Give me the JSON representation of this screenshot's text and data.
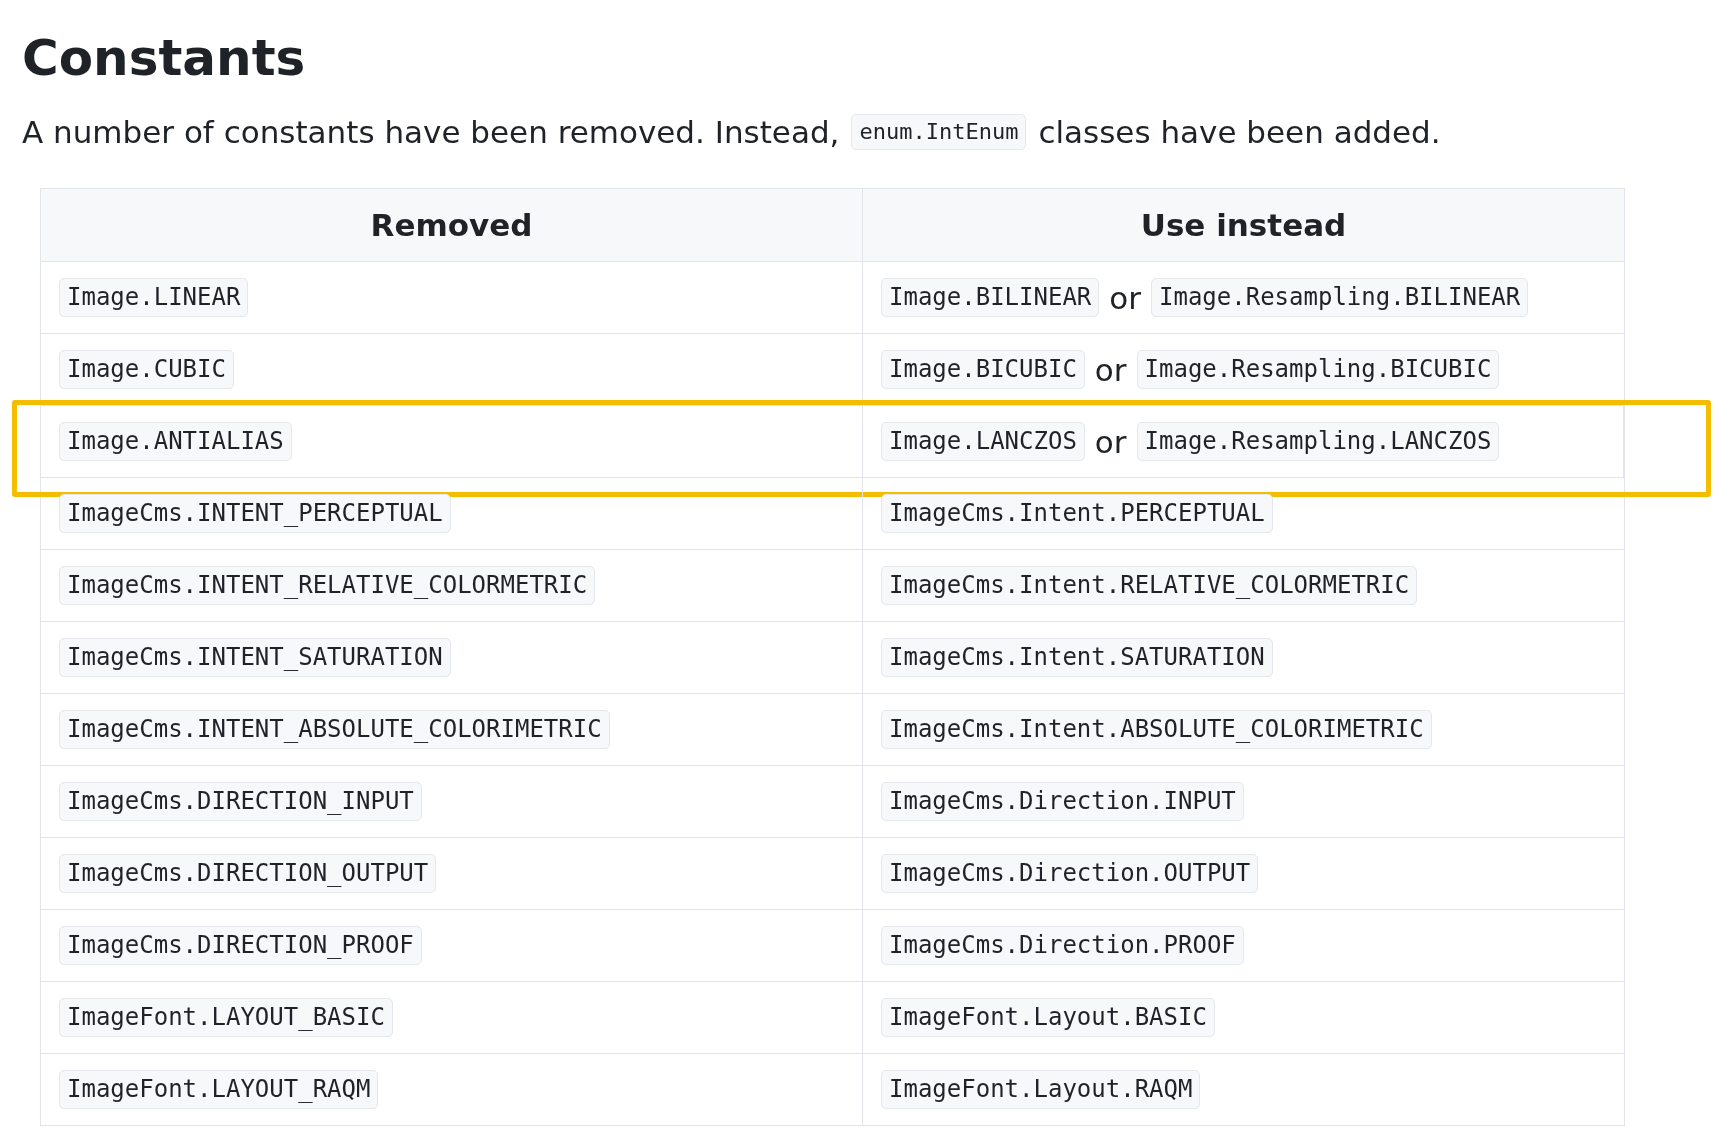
{
  "heading": "Constants",
  "intro": [
    {
      "kind": "text",
      "text": "A number of constants have been removed. Instead,"
    },
    {
      "kind": "code",
      "text": "enum.IntEnum"
    },
    {
      "kind": "text",
      "text": "classes have been added."
    }
  ],
  "table": {
    "columns": [
      "Removed",
      "Use instead"
    ],
    "rows": [
      {
        "removed": "Image.LINEAR",
        "use_instead": [
          {
            "kind": "code",
            "text": "Image.BILINEAR"
          },
          {
            "kind": "text",
            "text": "or"
          },
          {
            "kind": "code",
            "text": "Image.Resampling.BILINEAR"
          }
        ],
        "highlighted": false
      },
      {
        "removed": "Image.CUBIC",
        "use_instead": [
          {
            "kind": "code",
            "text": "Image.BICUBIC"
          },
          {
            "kind": "text",
            "text": "or"
          },
          {
            "kind": "code",
            "text": "Image.Resampling.BICUBIC"
          }
        ],
        "highlighted": false
      },
      {
        "removed": "Image.ANTIALIAS",
        "use_instead": [
          {
            "kind": "code",
            "text": "Image.LANCZOS"
          },
          {
            "kind": "text",
            "text": "or"
          },
          {
            "kind": "code",
            "text": "Image.Resampling.LANCZOS"
          }
        ],
        "highlighted": true
      },
      {
        "removed": "ImageCms.INTENT_PERCEPTUAL",
        "use_instead": [
          {
            "kind": "code",
            "text": "ImageCms.Intent.PERCEPTUAL"
          }
        ],
        "highlighted": false
      },
      {
        "removed": "ImageCms.INTENT_RELATIVE_COLORMETRIC",
        "use_instead": [
          {
            "kind": "code",
            "text": "ImageCms.Intent.RELATIVE_COLORMETRIC"
          }
        ],
        "highlighted": false
      },
      {
        "removed": "ImageCms.INTENT_SATURATION",
        "use_instead": [
          {
            "kind": "code",
            "text": "ImageCms.Intent.SATURATION"
          }
        ],
        "highlighted": false
      },
      {
        "removed": "ImageCms.INTENT_ABSOLUTE_COLORIMETRIC",
        "use_instead": [
          {
            "kind": "code",
            "text": "ImageCms.Intent.ABSOLUTE_COLORIMETRIC"
          }
        ],
        "highlighted": false
      },
      {
        "removed": "ImageCms.DIRECTION_INPUT",
        "use_instead": [
          {
            "kind": "code",
            "text": "ImageCms.Direction.INPUT"
          }
        ],
        "highlighted": false
      },
      {
        "removed": "ImageCms.DIRECTION_OUTPUT",
        "use_instead": [
          {
            "kind": "code",
            "text": "ImageCms.Direction.OUTPUT"
          }
        ],
        "highlighted": false
      },
      {
        "removed": "ImageCms.DIRECTION_PROOF",
        "use_instead": [
          {
            "kind": "code",
            "text": "ImageCms.Direction.PROOF"
          }
        ],
        "highlighted": false
      },
      {
        "removed": "ImageFont.LAYOUT_BASIC",
        "use_instead": [
          {
            "kind": "code",
            "text": "ImageFont.Layout.BASIC"
          }
        ],
        "highlighted": false
      },
      {
        "removed": "ImageFont.LAYOUT_RAQM",
        "use_instead": [
          {
            "kind": "code",
            "text": "ImageFont.Layout.RAQM"
          }
        ],
        "highlighted": false
      }
    ]
  }
}
